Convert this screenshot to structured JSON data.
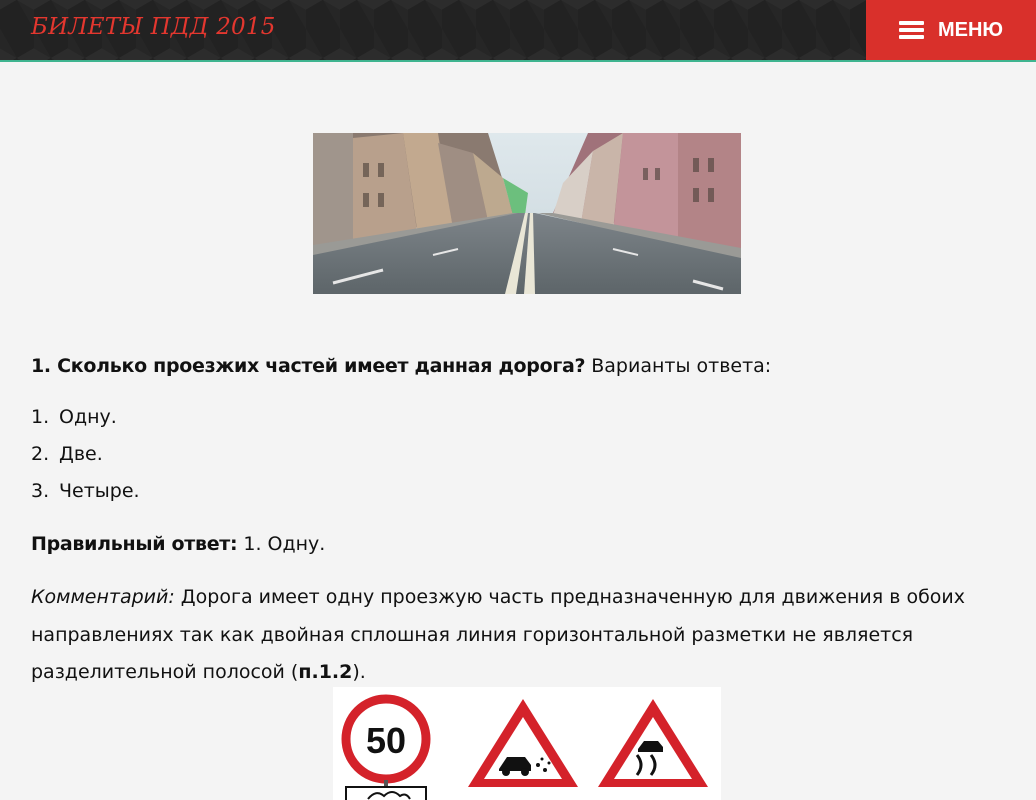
{
  "header": {
    "site_title": "БИЛЕТЫ ПДД 2015",
    "menu_label": "МЕНЮ"
  },
  "question": {
    "number_and_text": "1. Сколько проезжих частей имеет данная дорога?",
    "options_prompt": " Варианты ответа:",
    "answers": [
      {
        "num": "1.",
        "text": "Одну."
      },
      {
        "num": "2.",
        "text": "Две."
      },
      {
        "num": "3.",
        "text": "Четыре."
      }
    ]
  },
  "correct_answer": {
    "label": "Правильный ответ:",
    "value": " 1. Одну."
  },
  "comment": {
    "label": "Комментарий:",
    "text": " Дорога имеет одну проезжую часть предназначенную для движения в обоих направлениях так как двойная сплошная линия горизонтальной разметки не является разделительной полосой (",
    "rule": "п.1.2",
    "end": ")."
  },
  "signs": {
    "speed_limit": "50"
  },
  "colors": {
    "accent_red": "#d9302b",
    "title_red": "#e3372f",
    "header_dark": "#222222",
    "header_border": "#3fb48f"
  }
}
